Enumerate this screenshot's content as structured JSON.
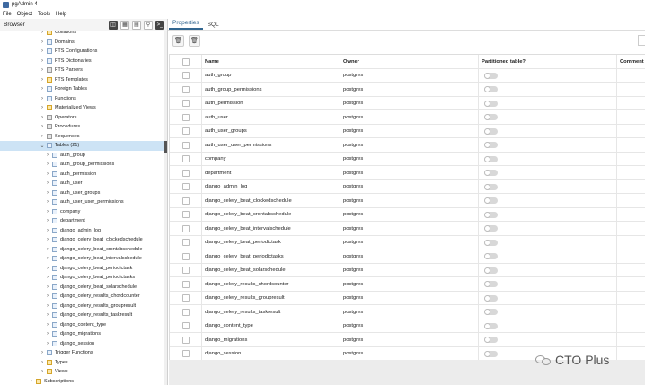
{
  "window": {
    "title": "pgAdmin 4"
  },
  "menu": [
    "File",
    "Object",
    "Tools",
    "Help"
  ],
  "browser": {
    "label": "Browser",
    "toolbar_icons": [
      "database-icon",
      "table-view-icon",
      "properties-icon",
      "search-icon",
      "terminal-icon"
    ],
    "tree": [
      {
        "label": "Collations",
        "level": 1,
        "icon": "yellow",
        "expanded": false
      },
      {
        "label": "Domains",
        "level": 1,
        "icon": "blue",
        "expanded": false
      },
      {
        "label": "FTS Configurations",
        "level": 1,
        "icon": "blue",
        "expanded": false
      },
      {
        "label": "FTS Dictionaries",
        "level": 1,
        "icon": "blue",
        "expanded": false
      },
      {
        "label": "FTS Parsers",
        "level": 1,
        "icon": "grey",
        "expanded": false
      },
      {
        "label": "FTS Templates",
        "level": 1,
        "icon": "yellow",
        "expanded": false
      },
      {
        "label": "Foreign Tables",
        "level": 1,
        "icon": "blue",
        "expanded": false
      },
      {
        "label": "Functions",
        "level": 1,
        "icon": "blue",
        "expanded": false
      },
      {
        "label": "Materialized Views",
        "level": 1,
        "icon": "yellow",
        "expanded": false
      },
      {
        "label": "Operators",
        "level": 1,
        "icon": "grey",
        "expanded": false
      },
      {
        "label": "Procedures",
        "level": 1,
        "icon": "grey",
        "expanded": false
      },
      {
        "label": "Sequences",
        "level": 1,
        "icon": "grey",
        "expanded": false
      },
      {
        "label": "Tables (21)",
        "level": 1,
        "icon": "blue",
        "expanded": true,
        "selected": true
      },
      {
        "label": "auth_group",
        "level": 2,
        "icon": "blue",
        "expanded": false
      },
      {
        "label": "auth_group_permissions",
        "level": 2,
        "icon": "blue",
        "expanded": false
      },
      {
        "label": "auth_permission",
        "level": 2,
        "icon": "blue",
        "expanded": false
      },
      {
        "label": "auth_user",
        "level": 2,
        "icon": "blue",
        "expanded": false
      },
      {
        "label": "auth_user_groups",
        "level": 2,
        "icon": "blue",
        "expanded": false
      },
      {
        "label": "auth_user_user_permissions",
        "level": 2,
        "icon": "blue",
        "expanded": false
      },
      {
        "label": "company",
        "level": 2,
        "icon": "blue",
        "expanded": false
      },
      {
        "label": "department",
        "level": 2,
        "icon": "blue",
        "expanded": false
      },
      {
        "label": "django_admin_log",
        "level": 2,
        "icon": "blue",
        "expanded": false
      },
      {
        "label": "django_celery_beat_clockedschedule",
        "level": 2,
        "icon": "blue",
        "expanded": false
      },
      {
        "label": "django_celery_beat_crontabschedule",
        "level": 2,
        "icon": "blue",
        "expanded": false
      },
      {
        "label": "django_celery_beat_intervalschedule",
        "level": 2,
        "icon": "blue",
        "expanded": false
      },
      {
        "label": "django_celery_beat_periodictask",
        "level": 2,
        "icon": "blue",
        "expanded": false
      },
      {
        "label": "django_celery_beat_periodictasks",
        "level": 2,
        "icon": "blue",
        "expanded": false
      },
      {
        "label": "django_celery_beat_solarschedule",
        "level": 2,
        "icon": "blue",
        "expanded": false
      },
      {
        "label": "django_celery_results_chordcounter",
        "level": 2,
        "icon": "blue",
        "expanded": false
      },
      {
        "label": "django_celery_results_groupresult",
        "level": 2,
        "icon": "blue",
        "expanded": false
      },
      {
        "label": "django_celery_results_taskresult",
        "level": 2,
        "icon": "blue",
        "expanded": false
      },
      {
        "label": "django_content_type",
        "level": 2,
        "icon": "blue",
        "expanded": false
      },
      {
        "label": "django_migrations",
        "level": 2,
        "icon": "blue",
        "expanded": false
      },
      {
        "label": "django_session",
        "level": 2,
        "icon": "blue",
        "expanded": false
      },
      {
        "label": "Trigger Functions",
        "level": 1,
        "icon": "blue",
        "expanded": false
      },
      {
        "label": "Types",
        "level": 1,
        "icon": "yellow",
        "expanded": false
      },
      {
        "label": "Views",
        "level": 1,
        "icon": "yellow",
        "expanded": false
      },
      {
        "label": "Subscriptions",
        "level": 0,
        "icon": "yellow",
        "expanded": false
      }
    ]
  },
  "tabs": [
    {
      "label": "Properties",
      "active": true
    },
    {
      "label": "SQL",
      "active": false
    }
  ],
  "toolbar": {
    "delete_icon": "trash-icon",
    "delete_cascade_icon": "trash-cascade-icon"
  },
  "table": {
    "columns": [
      "Name",
      "Owner",
      "Partitioned table?",
      "Comment"
    ],
    "rows": [
      {
        "name": "auth_group",
        "owner": "postgres"
      },
      {
        "name": "auth_group_permissions",
        "owner": "postgres"
      },
      {
        "name": "auth_permission",
        "owner": "postgres"
      },
      {
        "name": "auth_user",
        "owner": "postgres"
      },
      {
        "name": "auth_user_groups",
        "owner": "postgres"
      },
      {
        "name": "auth_user_user_permissions",
        "owner": "postgres"
      },
      {
        "name": "company",
        "owner": "postgres"
      },
      {
        "name": "department",
        "owner": "postgres"
      },
      {
        "name": "django_admin_log",
        "owner": "postgres"
      },
      {
        "name": "django_celery_beat_clockedschedule",
        "owner": "postgres"
      },
      {
        "name": "django_celery_beat_crontabschedule",
        "owner": "postgres"
      },
      {
        "name": "django_celery_beat_intervalschedule",
        "owner": "postgres"
      },
      {
        "name": "django_celery_beat_periodictask",
        "owner": "postgres"
      },
      {
        "name": "django_celery_beat_periodictasks",
        "owner": "postgres"
      },
      {
        "name": "django_celery_beat_solarschedule",
        "owner": "postgres"
      },
      {
        "name": "django_celery_results_chordcounter",
        "owner": "postgres"
      },
      {
        "name": "django_celery_results_groupresult",
        "owner": "postgres"
      },
      {
        "name": "django_celery_results_taskresult",
        "owner": "postgres"
      },
      {
        "name": "django_content_type",
        "owner": "postgres"
      },
      {
        "name": "django_migrations",
        "owner": "postgres"
      },
      {
        "name": "django_session",
        "owner": "postgres"
      }
    ]
  },
  "watermark": {
    "text": "CTO Plus"
  }
}
